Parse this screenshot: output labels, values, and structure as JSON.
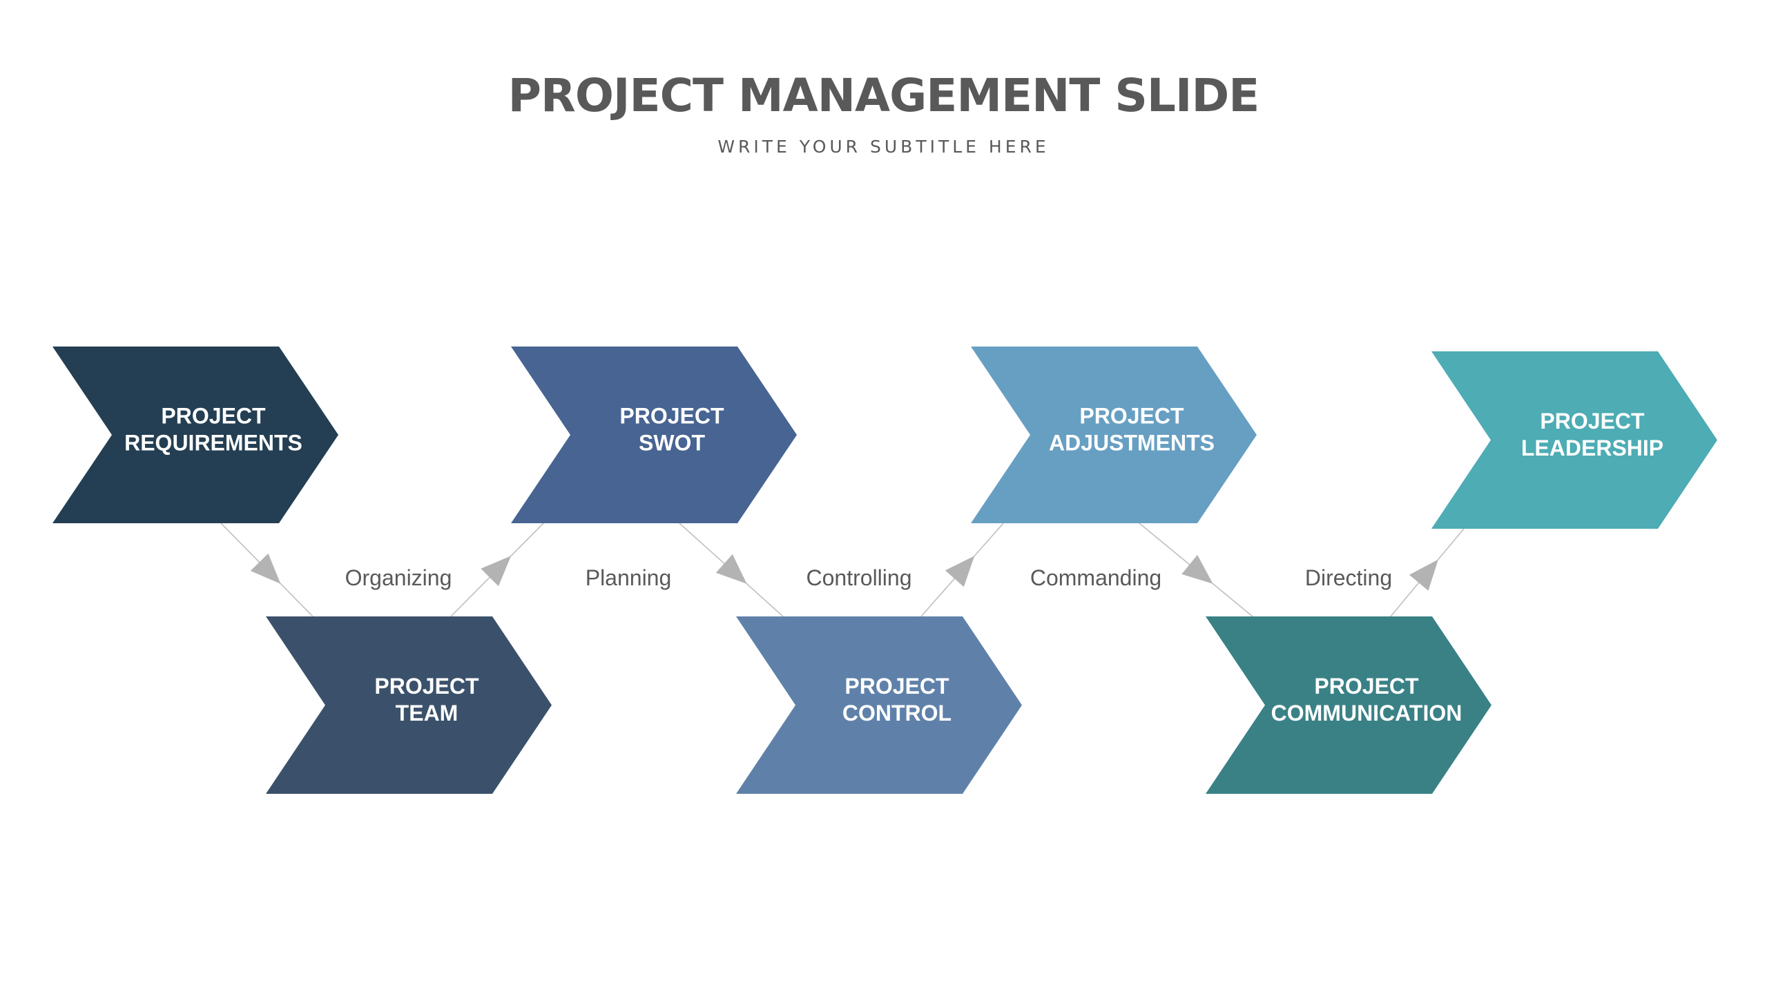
{
  "header": {
    "title": "PROJECT MANAGEMENT SLIDE",
    "subtitle": "WRITE YOUR SUBTITLE HERE"
  },
  "steps": [
    {
      "id": "requirements",
      "lines": [
        "PROJECT",
        "REQUIREMENTS"
      ],
      "color": "#243f53",
      "row": "top"
    },
    {
      "id": "team",
      "lines": [
        "PROJECT",
        "TEAM"
      ],
      "color": "#3b516b",
      "row": "bottom"
    },
    {
      "id": "swot",
      "lines": [
        "PROJECT",
        "SWOT"
      ],
      "color": "#476492",
      "row": "top"
    },
    {
      "id": "control",
      "lines": [
        "PROJECT",
        "CONTROL"
      ],
      "color": "#5f81a9",
      "row": "bottom"
    },
    {
      "id": "adjustments",
      "lines": [
        "PROJECT",
        "ADJUSTMENTS"
      ],
      "color": "#679fc2",
      "row": "top"
    },
    {
      "id": "communication",
      "lines": [
        "PROJECT",
        "COMMUNICATION"
      ],
      "color": "#3a8186",
      "row": "bottom"
    },
    {
      "id": "leadership",
      "lines": [
        "PROJECT",
        "LEADERSHIP"
      ],
      "color": "#4dacb4",
      "row": "top"
    }
  ],
  "connections": [
    {
      "from": "requirements",
      "to": "team",
      "direction": "down"
    },
    {
      "from": "team",
      "to": "swot",
      "direction": "up"
    },
    {
      "from": "swot",
      "to": "control",
      "direction": "down"
    },
    {
      "from": "control",
      "to": "adjustments",
      "direction": "up"
    },
    {
      "from": "adjustments",
      "to": "communication",
      "direction": "down"
    },
    {
      "from": "communication",
      "to": "leadership",
      "direction": "up"
    }
  ],
  "phase_labels": [
    "Organizing",
    "Planning",
    "Controlling",
    "Commanding",
    "Directing"
  ],
  "colors": {
    "connector_line": "#bfbfbf",
    "arrowhead": "#b3b3b3",
    "text_dark": "#595959"
  }
}
